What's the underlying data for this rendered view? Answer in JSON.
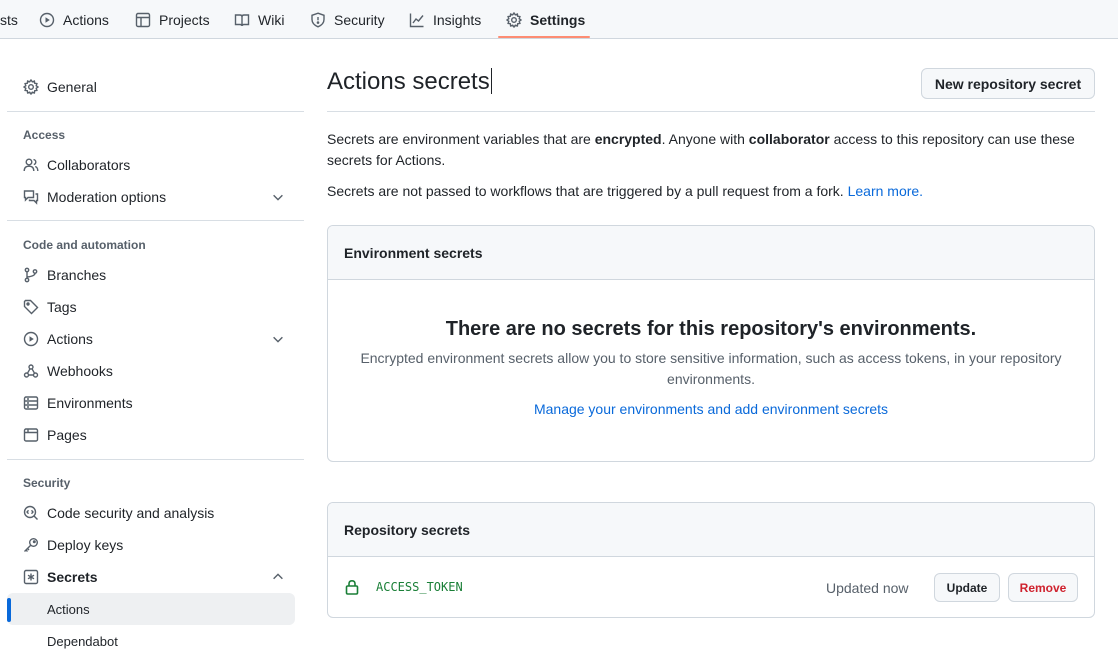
{
  "nav": {
    "tabs": [
      {
        "label": "sts",
        "icon": "pull-request-icon"
      },
      {
        "label": "Actions",
        "icon": "play-icon"
      },
      {
        "label": "Projects",
        "icon": "table-icon"
      },
      {
        "label": "Wiki",
        "icon": "book-icon"
      },
      {
        "label": "Security",
        "icon": "shield-icon"
      },
      {
        "label": "Insights",
        "icon": "graph-icon"
      },
      {
        "label": "Settings",
        "icon": "gear-icon",
        "active": true
      }
    ],
    "active_underline_color": "#fd8c73"
  },
  "sidebar": {
    "general": "General",
    "sections": [
      {
        "heading": "Access",
        "items": [
          "Collaborators",
          "Moderation options"
        ]
      },
      {
        "heading": "Code and automation",
        "items": [
          "Branches",
          "Tags",
          "Actions",
          "Webhooks",
          "Environments",
          "Pages"
        ]
      },
      {
        "heading": "Security",
        "items": [
          "Code security and analysis",
          "Deploy keys",
          "Secrets"
        ]
      }
    ],
    "secrets_sub": [
      "Actions",
      "Dependabot"
    ],
    "active_item": "Actions",
    "accent_color": "#0969da"
  },
  "main": {
    "title": "Actions secrets",
    "new_button": "New repository secret",
    "intro": {
      "p1_a": "Secrets are environment variables that are ",
      "p1_b": "encrypted",
      "p1_c": ". Anyone with ",
      "p1_d": "collaborator",
      "p1_e": " access to this repository can use these secrets for Actions.",
      "p2": "Secrets are not passed to workflows that are triggered by a pull request from a fork. ",
      "p2_link": "Learn more."
    },
    "env_box": {
      "header": "Environment secrets",
      "empty_title": "There are no secrets for this repository's environments.",
      "empty_text": "Encrypted environment secrets allow you to store sensitive information, such as access tokens, in your repository environments.",
      "manage_link": "Manage your environments and add environment secrets"
    },
    "repo_box": {
      "header": "Repository secrets",
      "secrets": [
        {
          "name": "ACCESS_TOKEN",
          "updated": "Updated now",
          "update_label": "Update",
          "remove_label": "Remove"
        }
      ]
    },
    "colors": {
      "link": "#0969da",
      "danger": "#cf222e",
      "success": "#1a7f37"
    }
  }
}
